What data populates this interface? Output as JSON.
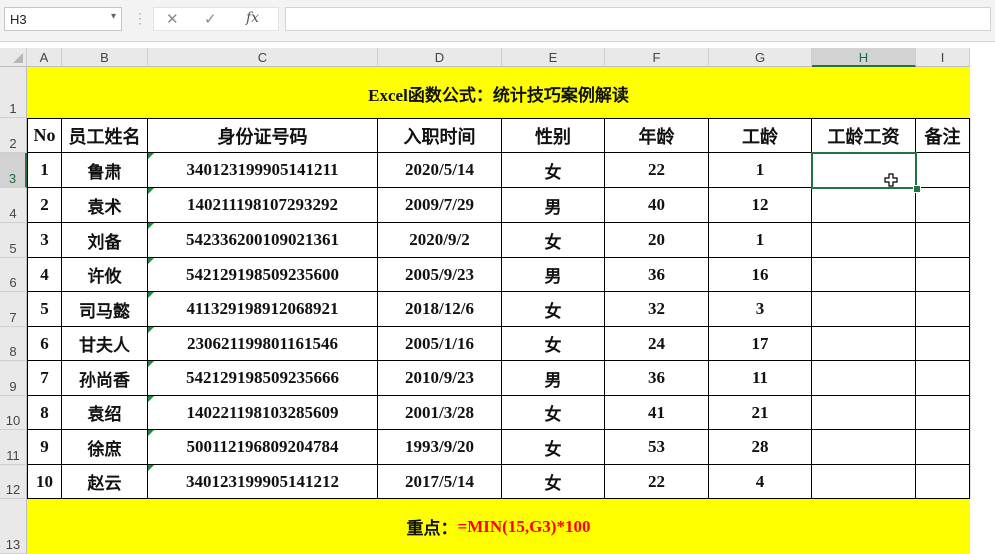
{
  "formula_bar": {
    "name_box": "H3",
    "name_box_arrow": "▾",
    "separator": "⋮",
    "cancel_icon": "✕",
    "enter_icon": "✓",
    "fx_label": "fx",
    "formula": ""
  },
  "columns": [
    "A",
    "B",
    "C",
    "D",
    "E",
    "F",
    "G",
    "H",
    "I"
  ],
  "rows": [
    "1",
    "2",
    "3",
    "4",
    "5",
    "6",
    "7",
    "8",
    "9",
    "10",
    "11",
    "12",
    "13"
  ],
  "title": "Excel函数公式：统计技巧案例解读",
  "headers": [
    "No",
    "员工姓名",
    "身份证号码",
    "入职时间",
    "性别",
    "年龄",
    "工龄",
    "工龄工资",
    "备注"
  ],
  "data": [
    [
      "1",
      "鲁肃",
      "340123199905141211",
      "2020/5/14",
      "女",
      "22",
      "1",
      "",
      ""
    ],
    [
      "2",
      "袁术",
      "140211198107293292",
      "2009/7/29",
      "男",
      "40",
      "12",
      "",
      ""
    ],
    [
      "3",
      "刘备",
      "542336200109021361",
      "2020/9/2",
      "女",
      "20",
      "1",
      "",
      ""
    ],
    [
      "4",
      "许攸",
      "542129198509235600",
      "2005/9/23",
      "男",
      "36",
      "16",
      "",
      ""
    ],
    [
      "5",
      "司马懿",
      "411329198912068921",
      "2018/12/6",
      "女",
      "32",
      "3",
      "",
      ""
    ],
    [
      "6",
      "甘夫人",
      "230621199801161546",
      "2005/1/16",
      "女",
      "24",
      "17",
      "",
      ""
    ],
    [
      "7",
      "孙尚香",
      "542129198509235666",
      "2010/9/23",
      "男",
      "36",
      "11",
      "",
      ""
    ],
    [
      "8",
      "袁绍",
      "140221198103285609",
      "2001/3/28",
      "女",
      "41",
      "21",
      "",
      ""
    ],
    [
      "9",
      "徐庶",
      "500112196809204784",
      "1993/9/20",
      "女",
      "53",
      "28",
      "",
      ""
    ],
    [
      "10",
      "赵云",
      "340123199905141212",
      "2017/5/14",
      "女",
      "22",
      "4",
      "",
      ""
    ]
  ],
  "note": {
    "label": "重点：",
    "formula": "=MIN(15,G3)*100"
  },
  "selected_cell": "H3",
  "icons": {
    "cursor": "excel-cross-cursor-icon"
  },
  "colors": {
    "highlight": "#ffff00",
    "accent": "#217346",
    "note_formula": "#ff0000"
  }
}
